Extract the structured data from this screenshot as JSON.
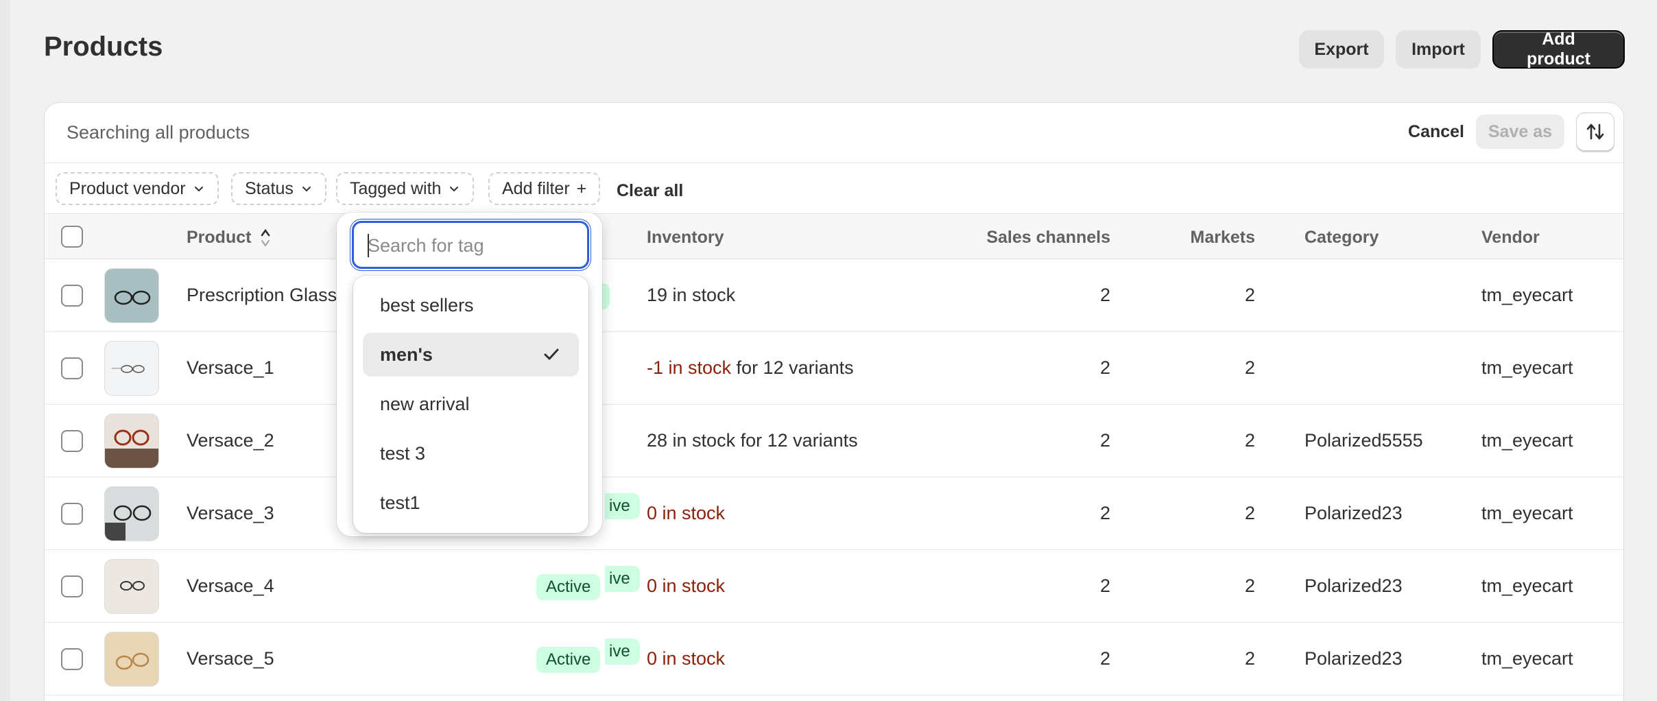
{
  "page": {
    "title": "Products"
  },
  "header_actions": {
    "export": "Export",
    "import": "Import",
    "add_product": "Add product"
  },
  "search": {
    "text": "Searching all products",
    "cancel": "Cancel",
    "save_as": "Save as"
  },
  "filters": {
    "vendor": "Product vendor",
    "status": "Status",
    "tagged_with": "Tagged with",
    "add_filter": "Add filter",
    "add_icon": "+",
    "clear_all": "Clear all"
  },
  "columns": {
    "product": "Product",
    "inventory": "Inventory",
    "sales_channels": "Sales channels",
    "markets": "Markets",
    "category": "Category",
    "vendor": "Vendor"
  },
  "rows": [
    {
      "name": "Prescription Glass",
      "status": "",
      "inventory_red": "",
      "inventory_rest": "19 in stock",
      "sales_channels": "2",
      "markets": "2",
      "category": "",
      "vendor": "tm_eyecart"
    },
    {
      "name": "Versace_1",
      "status": "",
      "inventory_red": "-1 in stock",
      "inventory_rest": " for 12 variants",
      "sales_channels": "2",
      "markets": "2",
      "category": "",
      "vendor": "tm_eyecart"
    },
    {
      "name": "Versace_2",
      "status": "",
      "inventory_red": "",
      "inventory_rest": "28 in stock for 12 variants",
      "sales_channels": "2",
      "markets": "2",
      "category": "Polarized5555",
      "vendor": "tm_eyecart"
    },
    {
      "name": "Versace_3",
      "status": "",
      "inventory_red": "0 in stock",
      "inventory_rest": "",
      "sales_channels": "2",
      "markets": "2",
      "category": "Polarized23",
      "vendor": "tm_eyecart"
    },
    {
      "name": "Versace_4",
      "status": "Active",
      "inventory_red": "0 in stock",
      "inventory_rest": "",
      "sales_channels": "2",
      "markets": "2",
      "category": "Polarized23",
      "vendor": "tm_eyecart"
    },
    {
      "name": "Versace_5",
      "status": "Active",
      "inventory_red": "0 in stock",
      "inventory_rest": "",
      "sales_channels": "2",
      "markets": "2",
      "category": "Polarized23",
      "vendor": "tm_eyecart"
    }
  ],
  "partial_badges": [
    "ive",
    "ive",
    "ive"
  ],
  "tag_popover": {
    "placeholder": "Search for tag",
    "options": [
      {
        "label": "best sellers",
        "selected": false
      },
      {
        "label": "men's",
        "selected": true
      },
      {
        "label": "new arrival",
        "selected": false
      },
      {
        "label": "test 3",
        "selected": false
      },
      {
        "label": "test1",
        "selected": false
      }
    ]
  },
  "colors": {
    "accent": "#2d5fd6",
    "primary_button": "#303030",
    "badge_bg": "#cdfee1",
    "critical_text": "#8e1f0b"
  },
  "icons": {
    "sort": "sort-arrows-icon",
    "chevron": "chevron-down-icon",
    "check": "checkmark-icon"
  }
}
